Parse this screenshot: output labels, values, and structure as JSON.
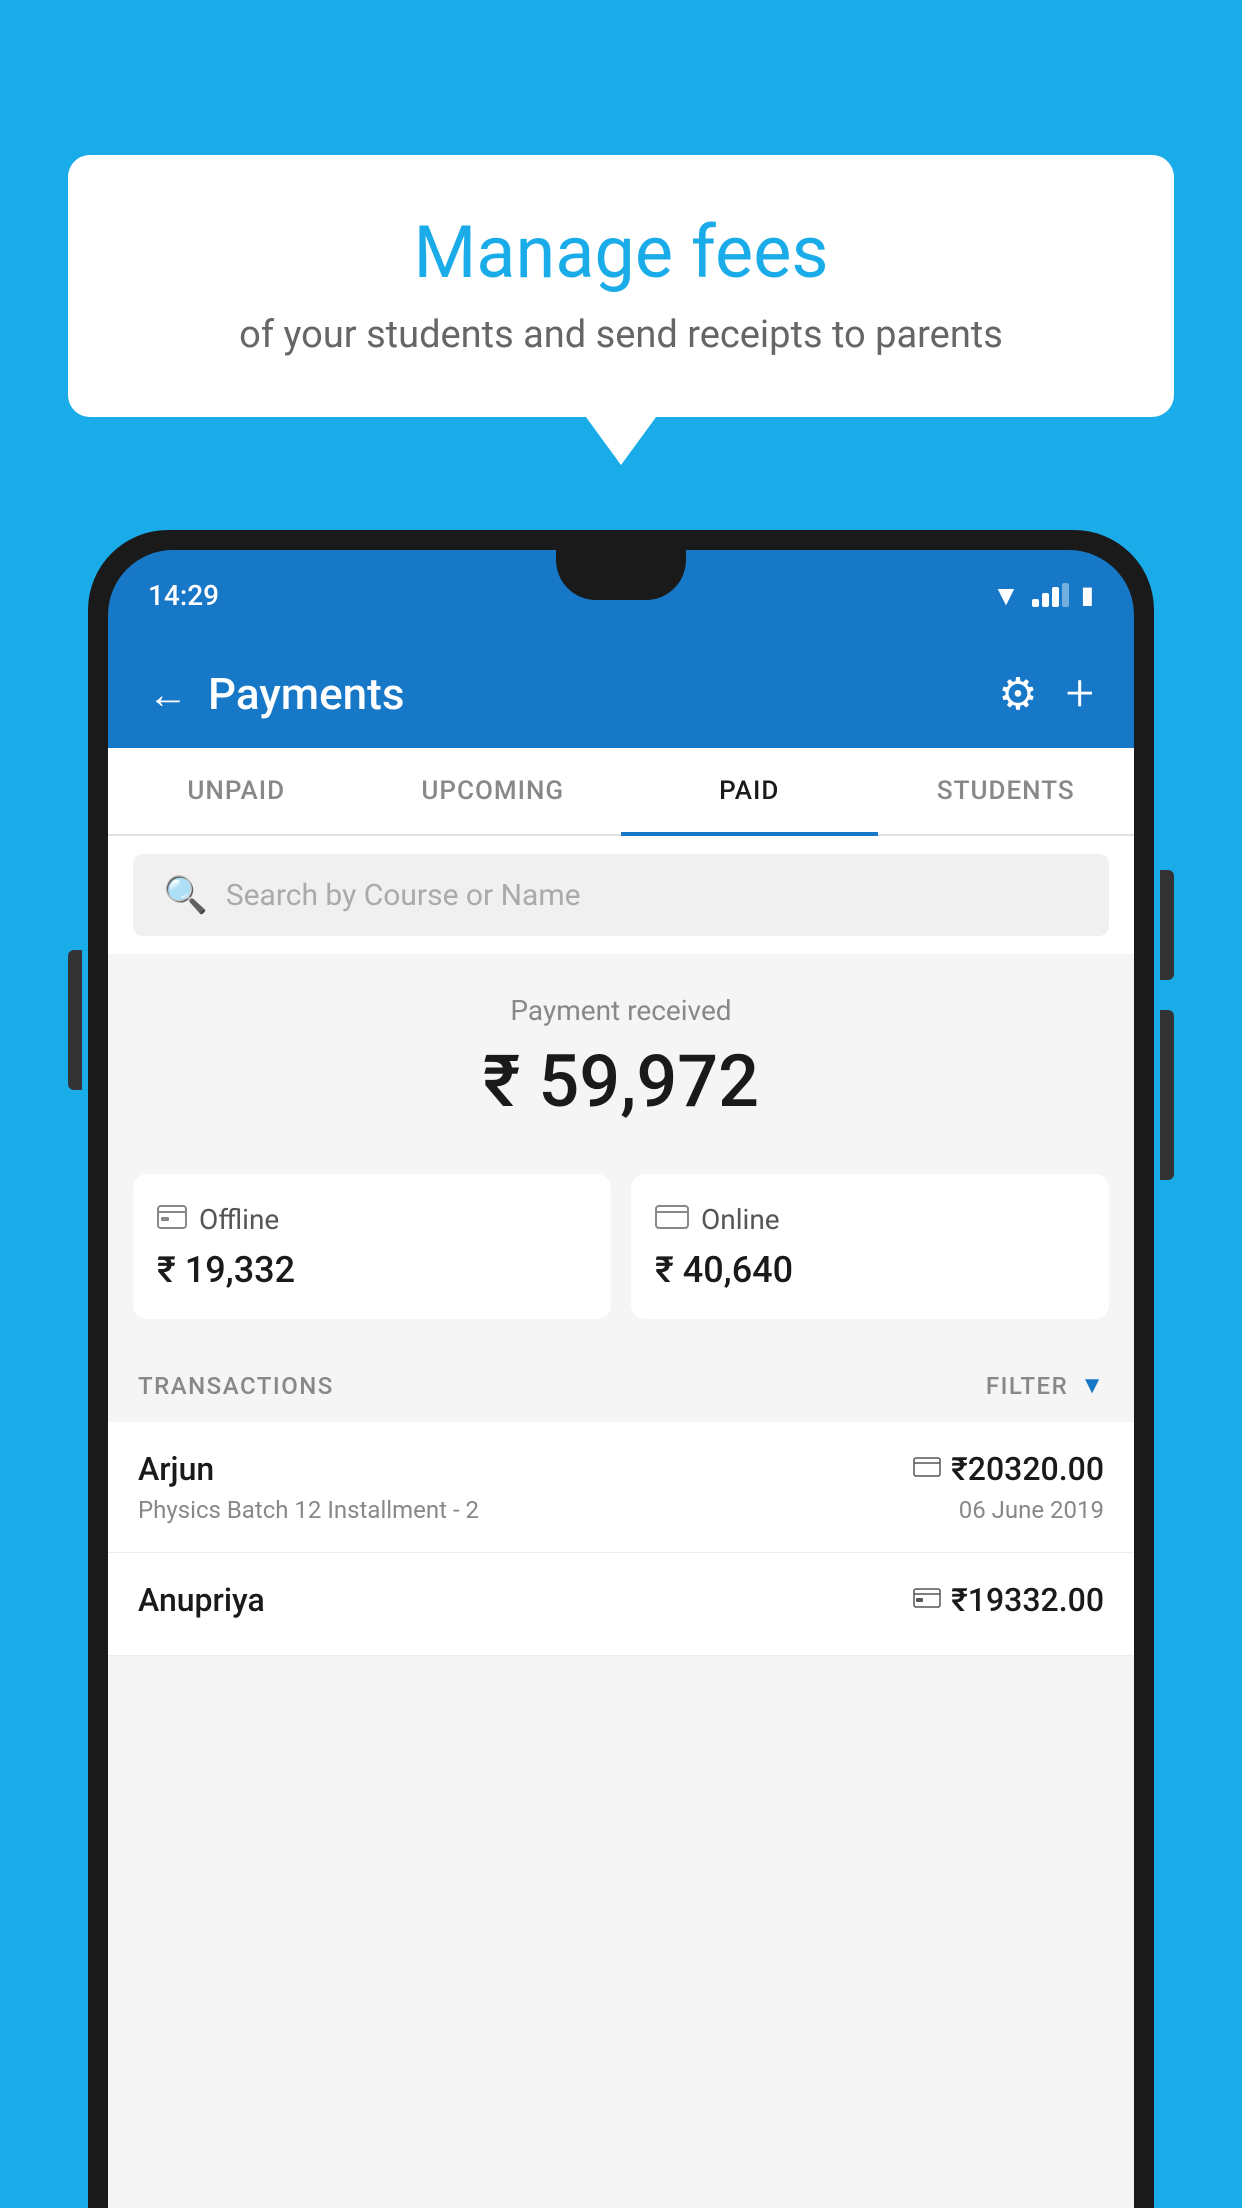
{
  "background_color": "#1AACE8",
  "speech_bubble": {
    "title": "Manage fees",
    "subtitle": "of your students and send receipts to parents"
  },
  "status_bar": {
    "time": "14:29"
  },
  "app_header": {
    "title": "Payments",
    "back_label": "←",
    "plus_label": "+"
  },
  "tabs": [
    {
      "label": "UNPAID",
      "active": false
    },
    {
      "label": "UPCOMING",
      "active": false
    },
    {
      "label": "PAID",
      "active": true
    },
    {
      "label": "STUDENTS",
      "active": false
    }
  ],
  "search": {
    "placeholder": "Search by Course or Name"
  },
  "payment_summary": {
    "label": "Payment received",
    "amount": "₹ 59,972",
    "offline": {
      "label": "Offline",
      "amount": "₹ 19,332"
    },
    "online": {
      "label": "Online",
      "amount": "₹ 40,640"
    }
  },
  "transactions": {
    "section_label": "TRANSACTIONS",
    "filter_label": "FILTER",
    "rows": [
      {
        "name": "Arjun",
        "detail": "Physics Batch 12 Installment - 2",
        "amount": "₹20320.00",
        "date": "06 June 2019",
        "mode": "online"
      },
      {
        "name": "Anupriya",
        "detail": "",
        "amount": "₹19332.00",
        "date": "",
        "mode": "offline"
      }
    ]
  }
}
